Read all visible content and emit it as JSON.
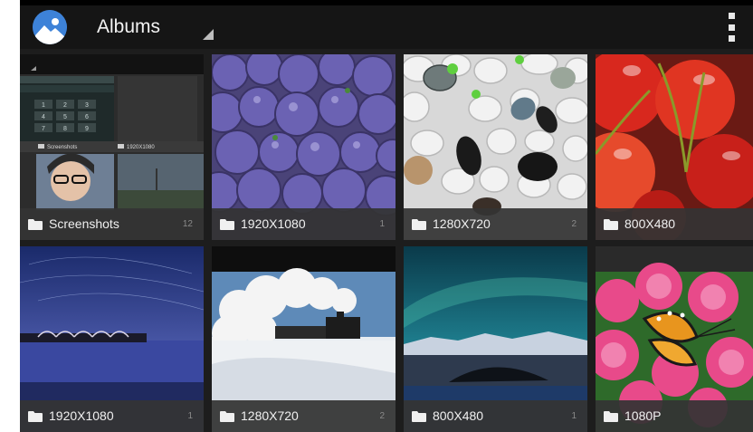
{
  "window": {
    "width": 832,
    "height": 477
  },
  "colors": {
    "action_bar": "#151515",
    "grid_bg": "#1d1d1d",
    "label_bar": "#343434",
    "app_icon": "#3d82d8",
    "title_text": "#f2f2f2",
    "count_text": "#8a8a8a"
  },
  "action_bar": {
    "title": "Albums",
    "icon": "gallery-icon",
    "menu_icon": "overflow-menu-icon"
  },
  "albums": [
    {
      "name": "Screenshots",
      "count": "12"
    },
    {
      "name": "1920X1080",
      "count": "1"
    },
    {
      "name": "1280X720",
      "count": "2"
    },
    {
      "name": "800X480",
      "count": ""
    },
    {
      "name": "1920X1080",
      "count": "1"
    },
    {
      "name": "1280X720",
      "count": "2"
    },
    {
      "name": "800X480",
      "count": "1"
    },
    {
      "name": "1080P",
      "count": ""
    }
  ],
  "screenshot_thumb": {
    "keys": [
      "1",
      "2",
      "3",
      "4",
      "5",
      "6",
      "7",
      "8",
      "9"
    ],
    "inner_labels": [
      "Screenshots",
      "1920X1080"
    ]
  }
}
